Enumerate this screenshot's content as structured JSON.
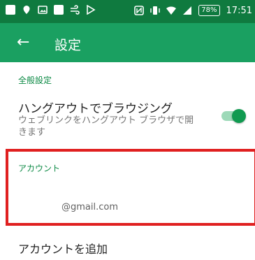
{
  "statusbar": {
    "icons_left": [
      "facebook-icon",
      "location-icon",
      "gallery-icon",
      "square-icon",
      "wind-icon",
      "play-store-icon"
    ],
    "icons_right": [
      "nfc-icon",
      "vibrate-icon",
      "wifi-icon",
      "signal-icon"
    ],
    "battery": "78%",
    "time": "17:51"
  },
  "toolbar": {
    "back_icon": "←",
    "title": "設定"
  },
  "general": {
    "header": "全般設定",
    "hangouts_title": "ハングアウトでブラウジング",
    "hangouts_desc": "ウェブリンクをハングアウト ブラウザで開きます",
    "hangouts_toggle": true
  },
  "account": {
    "header": "アカウント",
    "email": "@gmail.com",
    "add_label": "アカウントを追加"
  },
  "colors": {
    "statusbar": "#0f7a3f",
    "toolbar": "#1aa061",
    "accent": "#0d8a45",
    "highlight": "#e02020"
  }
}
